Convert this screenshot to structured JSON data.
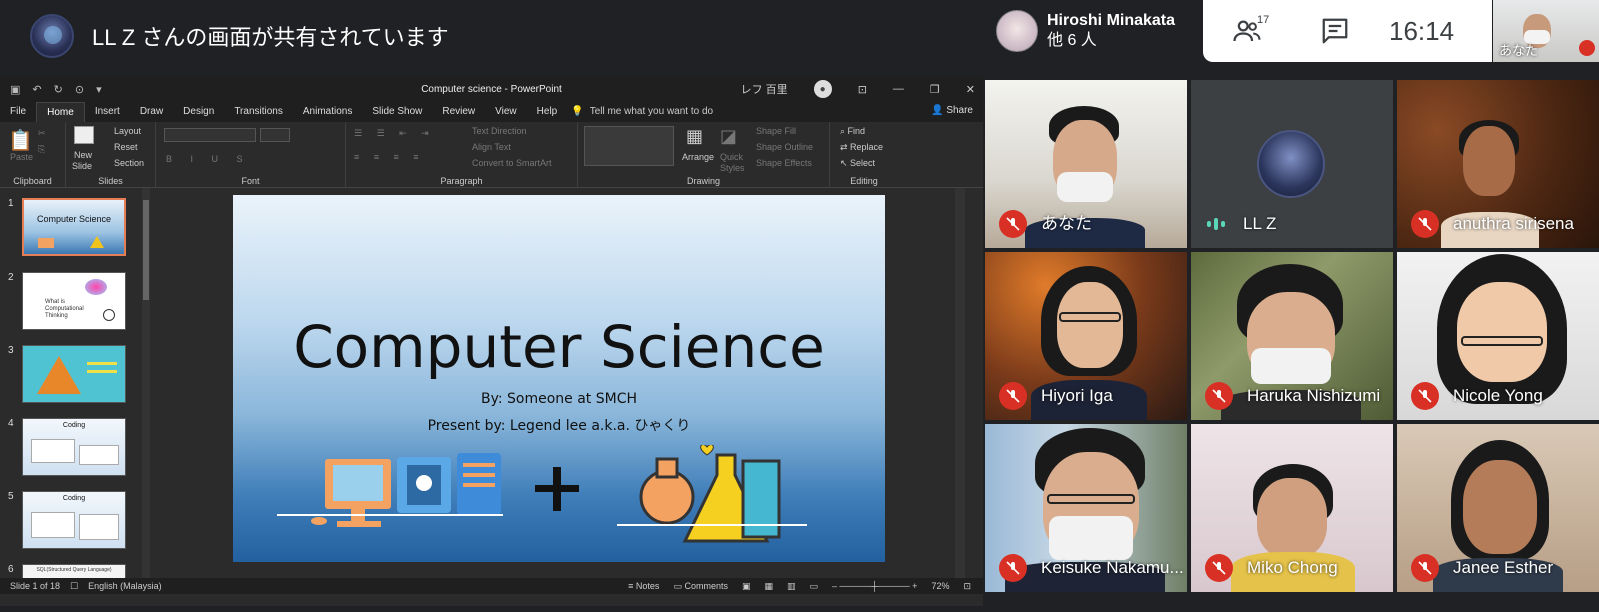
{
  "share_banner": {
    "text": "LL Z さんの画面が共有されています"
  },
  "meeting": {
    "host_name": "Hiroshi Minakata",
    "others": "他 6 人",
    "participant_count": "17",
    "clock": "16:14",
    "self_label": "あなた"
  },
  "ppt": {
    "doc_title": "Computer science  -  PowerPoint",
    "user_name": "レフ 百里",
    "tabs": [
      "File",
      "Home",
      "Insert",
      "Draw",
      "Design",
      "Transitions",
      "Animations",
      "Slide Show",
      "Review",
      "View",
      "Help"
    ],
    "tell_me": "Tell me what you want to do",
    "share": "Share",
    "ribbon": {
      "clipboard": "Clipboard",
      "paste": "Paste",
      "slides": "Slides",
      "new_slide": "New",
      "new_slide2": "Slide",
      "layout": "Layout",
      "reset": "Reset",
      "section": "Section",
      "font": "Font",
      "paragraph": "Paragraph",
      "text_direction": "Text Direction",
      "align_text": "Align Text",
      "convert_smartart": "Convert to SmartArt",
      "drawing": "Drawing",
      "arrange": "Arrange",
      "quick_styles": "Quick",
      "quick_styles2": "Styles",
      "shape_fill": "Shape Fill",
      "shape_outline": "Shape Outline",
      "shape_effects": "Shape Effects",
      "editing": "Editing",
      "find": "Find",
      "replace": "Replace",
      "select": "Select"
    },
    "thumbnails": [
      {
        "num": "1",
        "title": "Computer Science"
      },
      {
        "num": "2",
        "title": "What is Computational Thinking"
      },
      {
        "num": "3",
        "title": ""
      },
      {
        "num": "4",
        "title": "Coding"
      },
      {
        "num": "5",
        "title": "Coding"
      },
      {
        "num": "6",
        "title": "SQL(Structured Query Language)"
      }
    ],
    "slide": {
      "title": "Computer Science",
      "by": "By: Someone at SMCH",
      "presenter": "Present by: Legend lee a.k.a. ひゃくり"
    },
    "status": {
      "slide_of": "Slide 1 of 18",
      "language": "English (Malaysia)",
      "notes": "Notes",
      "comments": "Comments",
      "zoom": "72%"
    }
  },
  "participants": [
    {
      "name": "あなた",
      "muted": true
    },
    {
      "name": "LL Z",
      "muted": false
    },
    {
      "name": "anuthra sirisena",
      "muted": true
    },
    {
      "name": "Hiyori Iga",
      "muted": true
    },
    {
      "name": "Haruka Nishizumi",
      "muted": true
    },
    {
      "name": "Nicole Yong",
      "muted": true
    },
    {
      "name": "Keisuke Nakamu...",
      "muted": true
    },
    {
      "name": "Miko Chong",
      "muted": true
    },
    {
      "name": "Janee Esther",
      "muted": true
    }
  ],
  "colors": {
    "mute_red": "#d93025",
    "speaking_teal": "#5bd6b8",
    "thumb_selected": "#e67e55"
  }
}
